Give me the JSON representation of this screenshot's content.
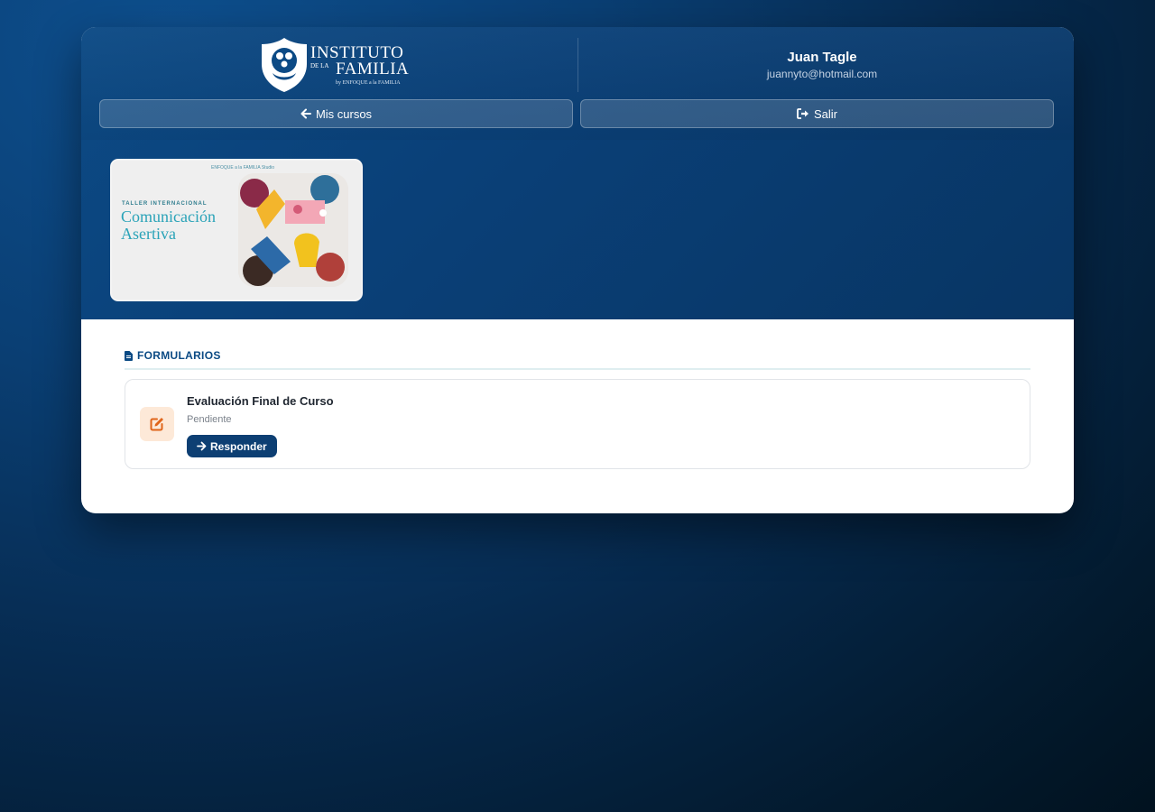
{
  "brand": {
    "logo_line1": "INSTITUTO",
    "logo_line2_small": "DE LA",
    "logo_line2": "FAMILIA",
    "logo_sub": "by ENFOQUE a la FAMILIA"
  },
  "user": {
    "name": "Juan Tagle",
    "email": "juannyto@hotmail.com"
  },
  "nav": {
    "my_courses_label": "Mis cursos",
    "my_courses_icon": "arrow-left-icon",
    "logout_label": "Salir",
    "logout_icon": "sign-out-icon"
  },
  "course_banner": {
    "brand_text": "ENFOQUE a la FAMILIA Studio",
    "kicker": "TALLER INTERNACIONAL",
    "title_line1": "Comunicación",
    "title_line2": "Asertiva"
  },
  "forms_section": {
    "title": "FORMULARIOS",
    "icon": "file-icon",
    "items": [
      {
        "title": "Evaluación Final de Curso",
        "status": "Pendiente",
        "action_label": "Responder",
        "icon": "edit-icon"
      }
    ]
  },
  "colors": {
    "primary": "#0d3f73",
    "accent_orange": "#e0651a",
    "icon_bg": "#fde9d8",
    "banner_title": "#2aa3b8"
  }
}
